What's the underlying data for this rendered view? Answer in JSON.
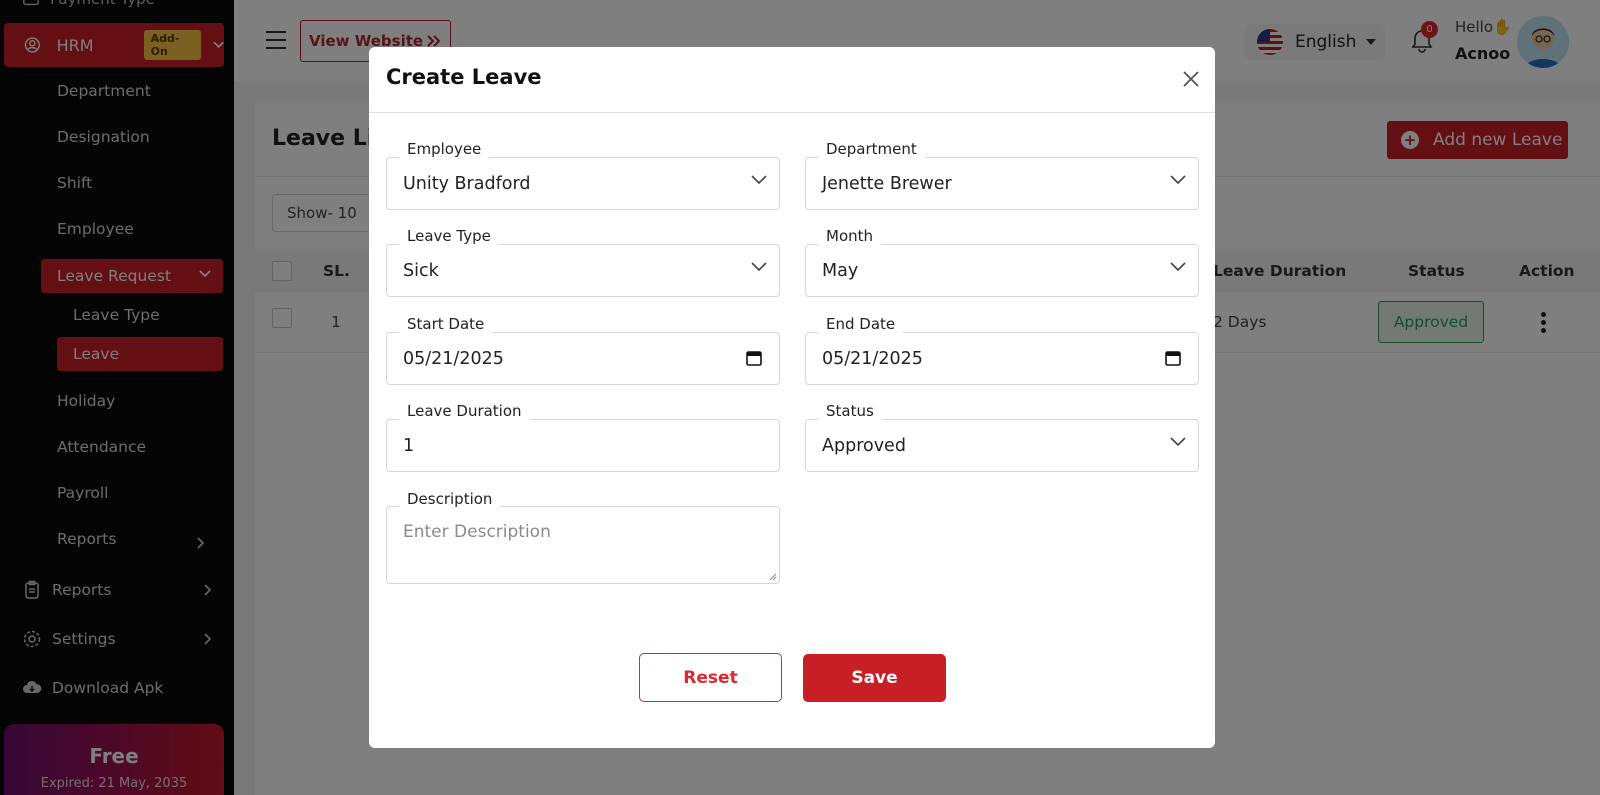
{
  "sidebar": {
    "top_cut_label": "Payment Type",
    "hrm_label": "HRM",
    "addon_badge": "Add-On",
    "items": [
      "Department",
      "Designation",
      "Shift",
      "Employee"
    ],
    "leave_request_label": "Leave Request",
    "sub_items": [
      "Leave Type",
      "Leave"
    ],
    "items2": [
      "Holiday",
      "Attendance",
      "Payroll",
      "Reports"
    ],
    "main": [
      "Reports",
      "Settings",
      "Download Apk"
    ],
    "plan": {
      "name": "Free",
      "expiry": "Expired: 21 May, 2035"
    }
  },
  "topbar": {
    "view_website": "View Website",
    "language": "English",
    "notifications": "0",
    "hello": "Hello",
    "hello_emoji": "✋",
    "user": "Acnoo"
  },
  "page": {
    "title": "Leave List",
    "add_button": "Add new Leave",
    "show": "Show- 10",
    "table": {
      "headers": {
        "sl": "SL.",
        "duration": "Leave Duration",
        "status": "Status",
        "action": "Action"
      },
      "rows": [
        {
          "sl": "1",
          "duration": "2 Days",
          "status": "Approved"
        }
      ]
    }
  },
  "modal": {
    "title": "Create Leave",
    "fields": {
      "employee": {
        "label": "Employee",
        "value": "Unity Bradford"
      },
      "department": {
        "label": "Department",
        "value": "Jenette Brewer"
      },
      "leave_type": {
        "label": "Leave Type",
        "value": "Sick"
      },
      "month": {
        "label": "Month",
        "value": "May"
      },
      "start_date": {
        "label": "Start Date",
        "value": "05/21/2025"
      },
      "end_date": {
        "label": "End Date",
        "value": "05/21/2025"
      },
      "leave_duration": {
        "label": "Leave Duration",
        "value": "1"
      },
      "status": {
        "label": "Status",
        "value": "Approved"
      },
      "description": {
        "label": "Description",
        "placeholder": "Enter Description"
      }
    },
    "reset_label": "Reset",
    "save_label": "Save"
  },
  "colors": {
    "brand_red": "#c81f26",
    "approved_green": "#2a9d5a",
    "sidebar_bg": "#0b0b0c"
  }
}
